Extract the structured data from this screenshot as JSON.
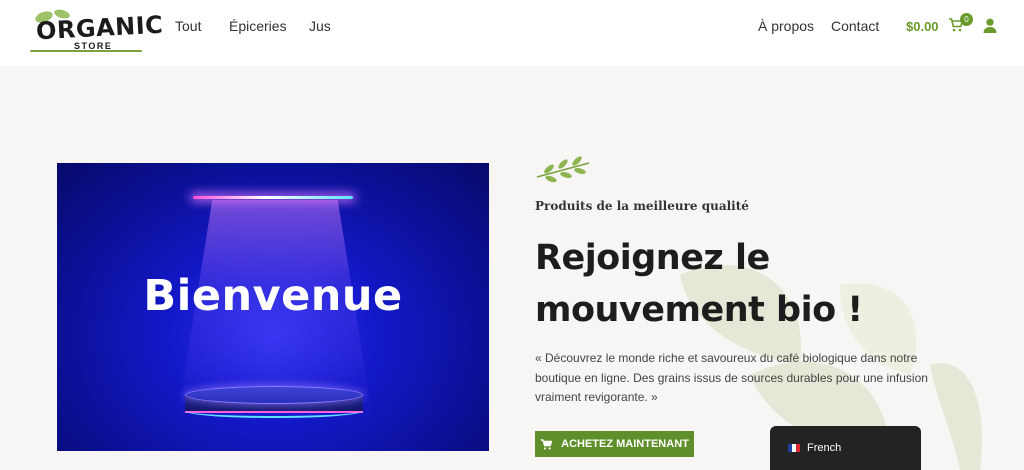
{
  "header": {
    "logo": {
      "title": "ORGANIC",
      "subtitle": "STORE"
    },
    "nav_left": [
      {
        "label": "Tout"
      },
      {
        "label": "Épiceries"
      },
      {
        "label": "Jus"
      }
    ],
    "nav_right": [
      {
        "label": "À propos"
      },
      {
        "label": "Contact"
      }
    ],
    "cart": {
      "amount": "$0.00",
      "count": "0",
      "icon": "cart-icon"
    },
    "account_icon": "user-icon"
  },
  "hero": {
    "image_text": "Bienvenue",
    "eyebrow": "Produits de la meilleure qualité",
    "headline": "Rejoignez le mouvement bio !",
    "description": "« Découvrez le monde riche et savoureux du café biologique dans notre boutique en ligne. Des grains issus de sources durables pour une infusion vraiment revigorante. »",
    "cta_label": "ACHETEZ MAINTENANT",
    "cta_icon": "cart-icon"
  },
  "language_switcher": {
    "label": "French",
    "flag_icon": "french-flag-icon"
  },
  "colors": {
    "brand_green": "#5f8f2a",
    "accent_green": "#6a9a2b",
    "header_bg": "#ffffff",
    "page_bg": "#f7f6f4",
    "hero_blue": "#1318c8",
    "switcher_bg": "#232323"
  }
}
